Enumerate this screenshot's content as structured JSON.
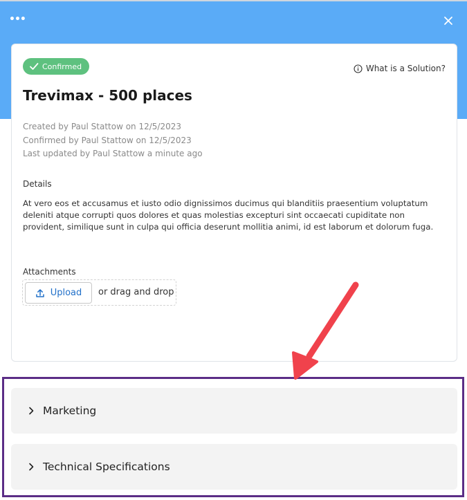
{
  "header": {
    "more_icon": "more-horizontal-icon",
    "more_text": "•••",
    "close_icon": "close-icon"
  },
  "card": {
    "status_badge": "Confirmed",
    "help_link": "What is a Solution?",
    "title": "Trevimax - 500 places",
    "created": "Created by Paul Stattow on 12/5/2023",
    "confirmed": "Confirmed by Paul Stattow on 12/5/2023",
    "updated": "Last updated by Paul Stattow a minute ago",
    "details_label": "Details",
    "details_text": "At vero eos et accusamus et iusto odio dignissimos ducimus qui blanditiis praesentium voluptatum deleniti atque corrupti quos dolores et quas molestias excepturi sint occaecati cupiditate non provident, similique sunt in culpa qui officia deserunt mollitia animi, id est laborum et dolorum fuga.",
    "attachments_label": "Attachments",
    "upload_label": "Upload",
    "drag_drop_text": "or drag and drop"
  },
  "sections": [
    {
      "label": "Marketing"
    },
    {
      "label": "Technical Specifications"
    }
  ],
  "colors": {
    "header_band": "#5aabf7",
    "badge": "#5ec17f",
    "link_blue": "#2170c9",
    "highlight_box": "#5b2d86",
    "annotation_arrow": "#f0424c"
  }
}
